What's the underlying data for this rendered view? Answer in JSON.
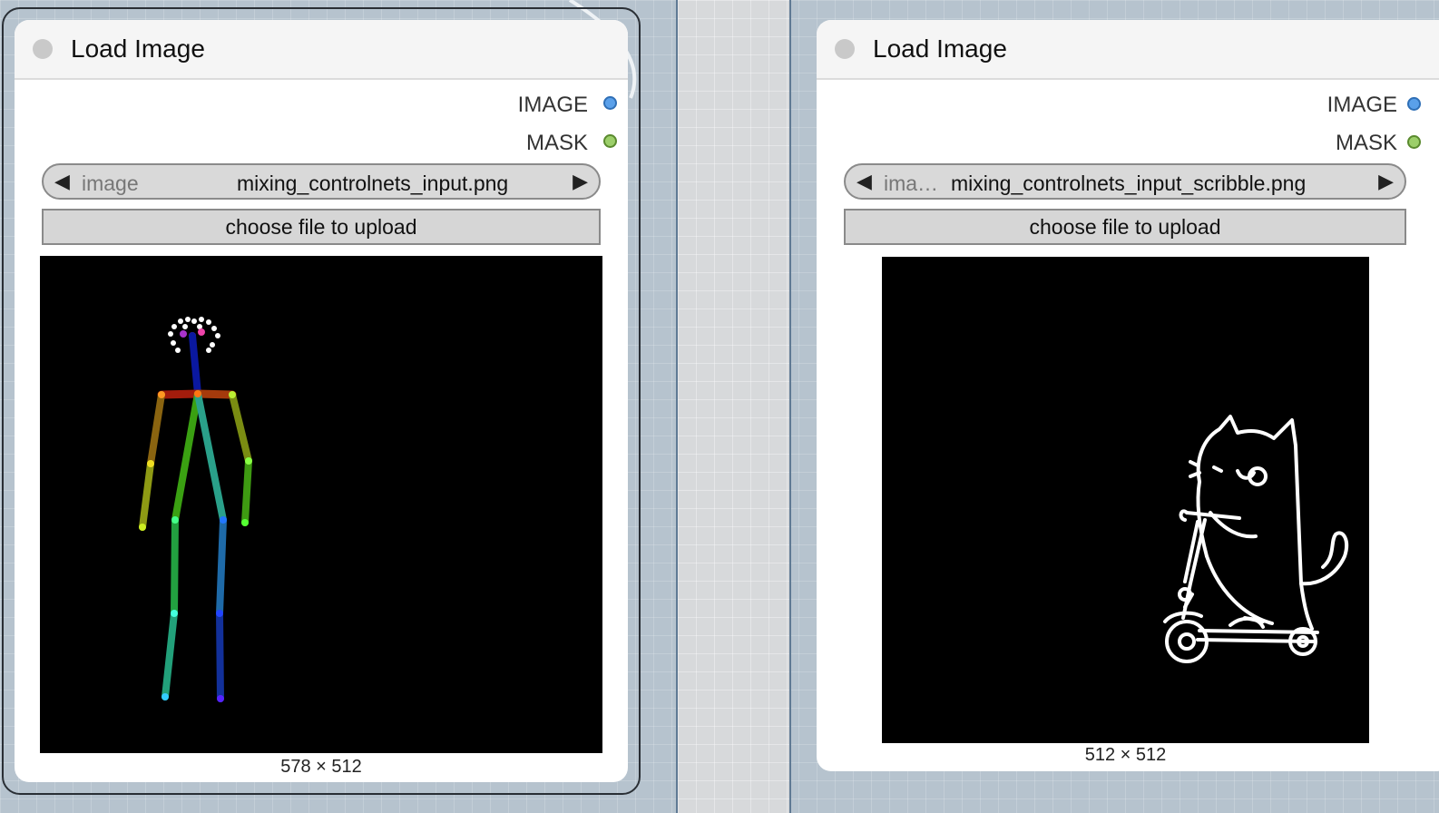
{
  "nodes": [
    {
      "title": "Load Image",
      "outputs": [
        {
          "label": "IMAGE",
          "color": "#5aa0ea"
        },
        {
          "label": "MASK",
          "color": "#9ccf6a"
        }
      ],
      "image_widget": {
        "label": "image",
        "value": "mixing_controlnets_input.png"
      },
      "upload_label": "choose file to upload",
      "preview_dims": "578 × 512"
    },
    {
      "title": "Load Image",
      "outputs": [
        {
          "label": "IMAGE",
          "color": "#5aa0ea"
        },
        {
          "label": "MASK",
          "color": "#9ccf6a"
        }
      ],
      "image_widget": {
        "label": "ima…",
        "value": "mixing_controlnets_input_scribble.png"
      },
      "upload_label": "choose file to upload",
      "preview_dims": "512 × 512"
    }
  ],
  "icons": {
    "prev": "triangle-left",
    "next": "triangle-right"
  }
}
